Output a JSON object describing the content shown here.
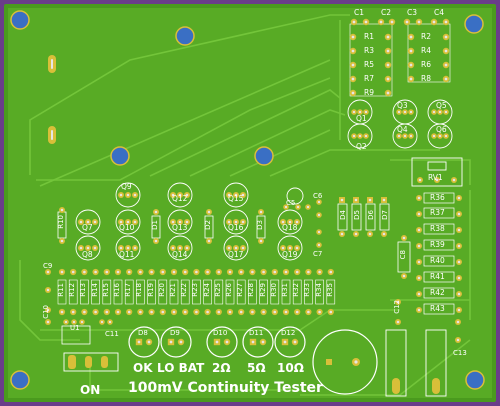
{
  "board": {
    "title": "100mV Continuity Tester",
    "colors": {
      "border": "#6a3d8a",
      "substrate": "#4a9a1e",
      "fill": "#5aad27",
      "trace": "#6fc235",
      "pad": "#d8bf39",
      "hole": "#e6e6e6",
      "silk": "#ffffff",
      "mount": "#3a6fc4"
    }
  },
  "caps_top": [
    "C1",
    "C2",
    "C3",
    "C4"
  ],
  "resistors_top_left": [
    "R1",
    "R3",
    "R5",
    "R7",
    "R9"
  ],
  "resistors_top_right": [
    "R2",
    "R4",
    "R6",
    "R8"
  ],
  "transistors_top": [
    "Q1",
    "Q2",
    "Q3",
    "Q4",
    "Q5",
    "Q6"
  ],
  "trimmer": "RV1",
  "transistor_rows": {
    "upper": [
      "Q9",
      "Q12",
      "Q15"
    ],
    "mid": [
      "Q7",
      "Q10",
      "Q13",
      "Q16",
      "Q18"
    ],
    "lower": [
      "Q8",
      "Q11",
      "Q14",
      "Q17",
      "Q19"
    ]
  },
  "small_parts": [
    "R10",
    "D1",
    "D2",
    "D3",
    "C5",
    "C6",
    "C7",
    "C8",
    "C9",
    "C10",
    "C11",
    "C12",
    "C13",
    "U1"
  ],
  "diodes_right": [
    "D4",
    "D5",
    "D6",
    "D7"
  ],
  "resistors_right": [
    "R36",
    "R37",
    "R38",
    "R39",
    "R40",
    "R41",
    "R42",
    "R43"
  ],
  "resistor_bank": [
    "R11",
    "R12",
    "R13",
    "R14",
    "R15",
    "R16",
    "R17",
    "R18",
    "R19",
    "R20",
    "R21",
    "R22",
    "R23",
    "R24",
    "R25",
    "R26",
    "R27",
    "R28",
    "R29",
    "R30",
    "R31",
    "R32",
    "R33",
    "R34",
    "R35"
  ],
  "leds": [
    {
      "ref": "D8",
      "label": "OK"
    },
    {
      "ref": "D9",
      "label": "LO BAT"
    },
    {
      "ref": "D10",
      "label": "2Ω"
    },
    {
      "ref": "D11",
      "label": "5Ω"
    },
    {
      "ref": "D12",
      "label": "10Ω"
    }
  ],
  "switch_label": "ON"
}
